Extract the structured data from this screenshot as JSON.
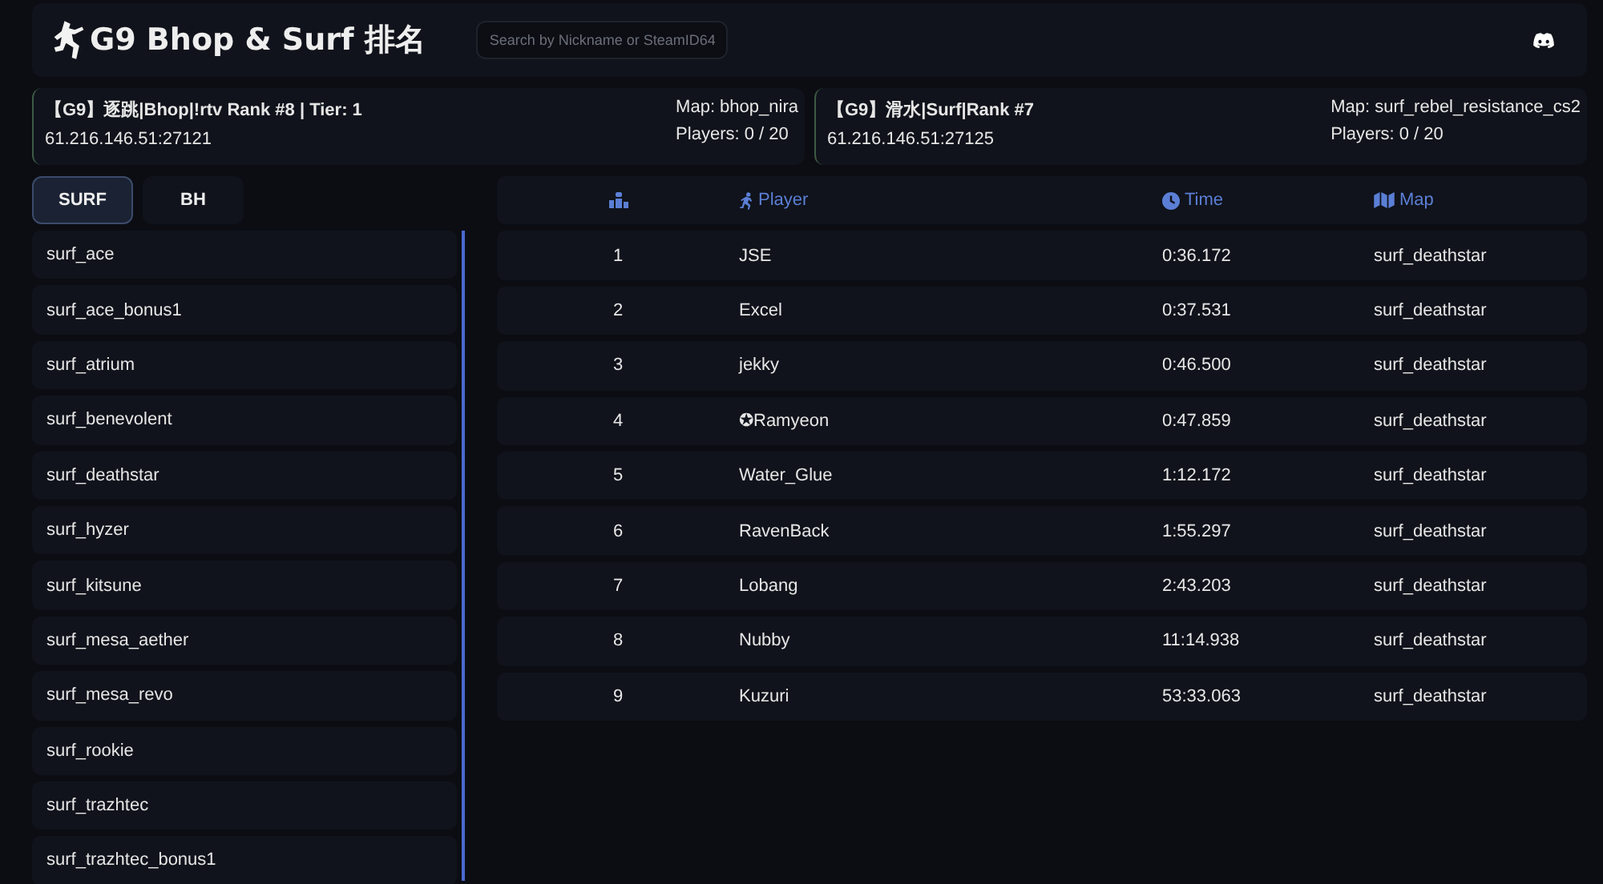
{
  "header": {
    "title": "G9 Bhop & Surf 排名",
    "search": {
      "placeholder": "Search by Nickname or SteamID64"
    }
  },
  "servers": [
    {
      "name": "【G9】逐跳|Bhop|!rtv Rank #8 | Tier: 1",
      "address": "61.216.146.51:27121",
      "map": "Map: bhop_nira",
      "players": "Players: 0 / 20"
    },
    {
      "name": "【G9】滑水|Surf|Rank #7",
      "address": "61.216.146.51:27125",
      "map": "Map: surf_rebel_resistance_cs2",
      "players": "Players: 0 / 20"
    }
  ],
  "tabs": [
    {
      "label": "SURF",
      "selected": true
    },
    {
      "label": "BH",
      "selected": false
    }
  ],
  "maps": [
    {
      "name": "surf_ace"
    },
    {
      "name": "surf_ace_bonus1"
    },
    {
      "name": "surf_atrium"
    },
    {
      "name": "surf_benevolent"
    },
    {
      "name": "surf_deathstar"
    },
    {
      "name": "surf_hyzer"
    },
    {
      "name": "surf_kitsune"
    },
    {
      "name": "surf_mesa_aether"
    },
    {
      "name": "surf_mesa_revo"
    },
    {
      "name": "surf_rookie"
    },
    {
      "name": "surf_trazhtec"
    },
    {
      "name": "surf_trazhtec_bonus1"
    }
  ],
  "table": {
    "columns": [
      {
        "kind": "rank"
      },
      {
        "kind": "player",
        "label": "Player"
      },
      {
        "kind": "time",
        "label": "Time"
      },
      {
        "kind": "map",
        "label": "Map"
      }
    ],
    "rows": [
      {
        "rank": "1",
        "player": "JSE",
        "time": "0:36.172",
        "map": "surf_deathstar"
      },
      {
        "rank": "2",
        "player": "Excel",
        "time": "0:37.531",
        "map": "surf_deathstar"
      },
      {
        "rank": "3",
        "player": "jekky",
        "time": "0:46.500",
        "map": "surf_deathstar"
      },
      {
        "rank": "4",
        "player": "✪Ramyeon",
        "time": "0:47.859",
        "map": "surf_deathstar"
      },
      {
        "rank": "5",
        "player": "Water_Glue",
        "time": "1:12.172",
        "map": "surf_deathstar"
      },
      {
        "rank": "6",
        "player": "RavenBack",
        "time": "1:55.297",
        "map": "surf_deathstar"
      },
      {
        "rank": "7",
        "player": "Lobang",
        "time": "2:43.203",
        "map": "surf_deathstar"
      },
      {
        "rank": "8",
        "player": "Nubby",
        "time": "11:14.938",
        "map": "surf_deathstar"
      },
      {
        "rank": "9",
        "player": "Kuzuri",
        "time": "53:33.063",
        "map": "surf_deathstar"
      }
    ]
  }
}
